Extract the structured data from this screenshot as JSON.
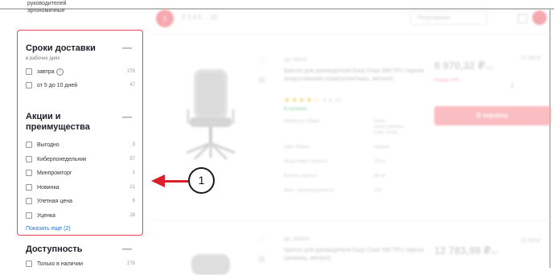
{
  "sidebar": {
    "prev_category_line1": "руководителей",
    "prev_category_line2": "эргономичные",
    "delivery": {
      "title": "Сроки доставки",
      "subtitle": "в рабочих днях",
      "collapse_symbol": "—",
      "options": [
        {
          "label": "завтра",
          "count": "276",
          "has_info": true
        },
        {
          "label": "от 5 до 10 дней",
          "count": "47"
        }
      ]
    },
    "promotions": {
      "title_line1": "Акции и",
      "title_line2": "преимущества",
      "collapse_symbol": "—",
      "options": [
        {
          "label": "Выгодно",
          "count": "3"
        },
        {
          "label": "Киберпонедельник",
          "count": "57"
        },
        {
          "label": "Минпромторг",
          "count": "1"
        },
        {
          "label": "Новинка",
          "count": "21"
        },
        {
          "label": "Улетная цена",
          "count": "6"
        },
        {
          "label": "Уценка",
          "count": "28"
        }
      ],
      "show_more": "Показать еще (2)"
    },
    "availability": {
      "title": "Доступность",
      "collapse_symbol": "—",
      "options": [
        {
          "label": "Только в наличии",
          "count": "276"
        }
      ]
    }
  },
  "toolbar": {
    "current_page": "1",
    "pages": "2   3   4   5   ...   15",
    "sort_label": "Популярные"
  },
  "products": [
    {
      "sku": "арт. 99214",
      "name": "Кресло для руководителя Easy Chair 588 TPU черное (искусственная кожа/сетка/ткань, металл)",
      "rating": "4.4",
      "reviews": "17",
      "availability": "В наличии",
      "specs": [
        {
          "k": "Материал обивки",
          "v": "ткань, искусственная кожа, сетка"
        },
        {
          "k": "Цвет обивки",
          "v": "черный"
        },
        {
          "k": "Допустимая нагрузка",
          "v": "120 кг"
        },
        {
          "k": "Высота сиденья",
          "v": "46 см"
        },
        {
          "k": "Макс. грузоподъемность",
          "v": "120"
        }
      ],
      "price": "8 970,32 ₽",
      "price_unit": "/шт.",
      "old_price": "10 493 ₽",
      "discount_note": "Скидка 15%",
      "qty": "1",
      "cart_label": "В корзину"
    },
    {
      "sku": "арт. 968534",
      "name": "Кресло для руководителя Easy Chair 595 TPU черное (экокожа, металл)",
      "price": "12 783,98 ₽",
      "price_unit": "/шт.",
      "old_price": "15 039 ₽"
    }
  ],
  "annotation": {
    "number": "1"
  },
  "colors": {
    "accent": "#e8435a",
    "arrow": "#d81f2a",
    "link": "#2a74c9"
  }
}
